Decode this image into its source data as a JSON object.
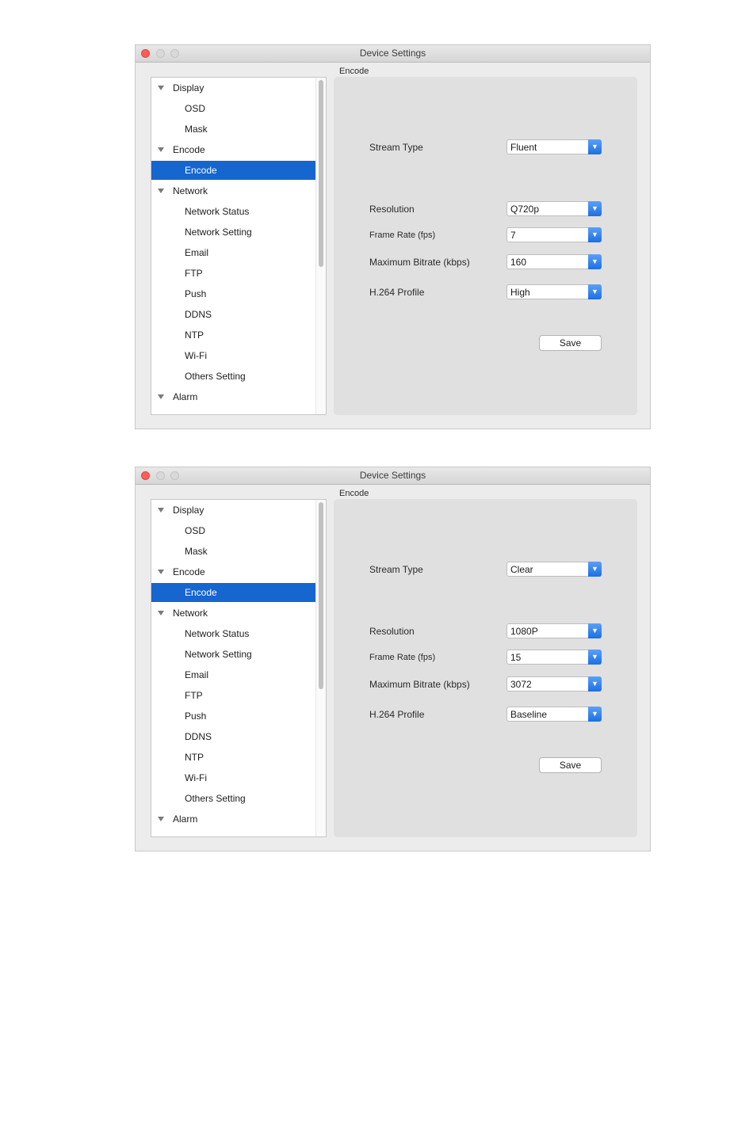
{
  "windows": [
    {
      "title": "Device Settings",
      "panel_caption": "Encode",
      "tree": [
        {
          "label": "Display",
          "level": 0,
          "expanded": true
        },
        {
          "label": "OSD",
          "level": 1
        },
        {
          "label": "Mask",
          "level": 1
        },
        {
          "label": "Encode",
          "level": 0,
          "expanded": true
        },
        {
          "label": "Encode",
          "level": 1,
          "selected": true
        },
        {
          "label": "Network",
          "level": 0,
          "expanded": true
        },
        {
          "label": "Network Status",
          "level": 1
        },
        {
          "label": "Network Setting",
          "level": 1
        },
        {
          "label": "Email",
          "level": 1
        },
        {
          "label": "FTP",
          "level": 1
        },
        {
          "label": "Push",
          "level": 1
        },
        {
          "label": "DDNS",
          "level": 1
        },
        {
          "label": "NTP",
          "level": 1
        },
        {
          "label": "Wi-Fi",
          "level": 1
        },
        {
          "label": "Others Setting",
          "level": 1
        },
        {
          "label": "Alarm",
          "level": 0,
          "expanded": true
        }
      ],
      "fields": [
        {
          "label": "Stream Type",
          "value": "Fluent"
        },
        {
          "label": "Resolution",
          "value": "Q720p"
        },
        {
          "label": "Frame Rate (fps)",
          "value": "7"
        },
        {
          "label": "Maximum Bitrate (kbps)",
          "value": "160"
        },
        {
          "label": "H.264 Profile",
          "value": "High"
        }
      ],
      "save_label": "Save"
    },
    {
      "title": "Device Settings",
      "panel_caption": "Encode",
      "tree": [
        {
          "label": "Display",
          "level": 0,
          "expanded": true
        },
        {
          "label": "OSD",
          "level": 1
        },
        {
          "label": "Mask",
          "level": 1
        },
        {
          "label": "Encode",
          "level": 0,
          "expanded": true
        },
        {
          "label": "Encode",
          "level": 1,
          "selected": true
        },
        {
          "label": "Network",
          "level": 0,
          "expanded": true
        },
        {
          "label": "Network Status",
          "level": 1
        },
        {
          "label": "Network Setting",
          "level": 1
        },
        {
          "label": "Email",
          "level": 1
        },
        {
          "label": "FTP",
          "level": 1
        },
        {
          "label": "Push",
          "level": 1
        },
        {
          "label": "DDNS",
          "level": 1
        },
        {
          "label": "NTP",
          "level": 1
        },
        {
          "label": "Wi-Fi",
          "level": 1
        },
        {
          "label": "Others Setting",
          "level": 1
        },
        {
          "label": "Alarm",
          "level": 0,
          "expanded": true
        }
      ],
      "fields": [
        {
          "label": "Stream Type",
          "value": "Clear"
        },
        {
          "label": "Resolution",
          "value": "1080P"
        },
        {
          "label": "Frame Rate (fps)",
          "value": "15"
        },
        {
          "label": "Maximum Bitrate (kbps)",
          "value": "3072"
        },
        {
          "label": "H.264 Profile",
          "value": "Baseline"
        }
      ],
      "save_label": "Save"
    }
  ],
  "colors": {
    "selection": "#1566cf",
    "close_button": "#fc5f57",
    "dropdown_arrow": "#1c6fe2"
  },
  "icons": {
    "disclosure": "disclosure-triangle-icon",
    "dropdown": "chevron-down-icon"
  }
}
